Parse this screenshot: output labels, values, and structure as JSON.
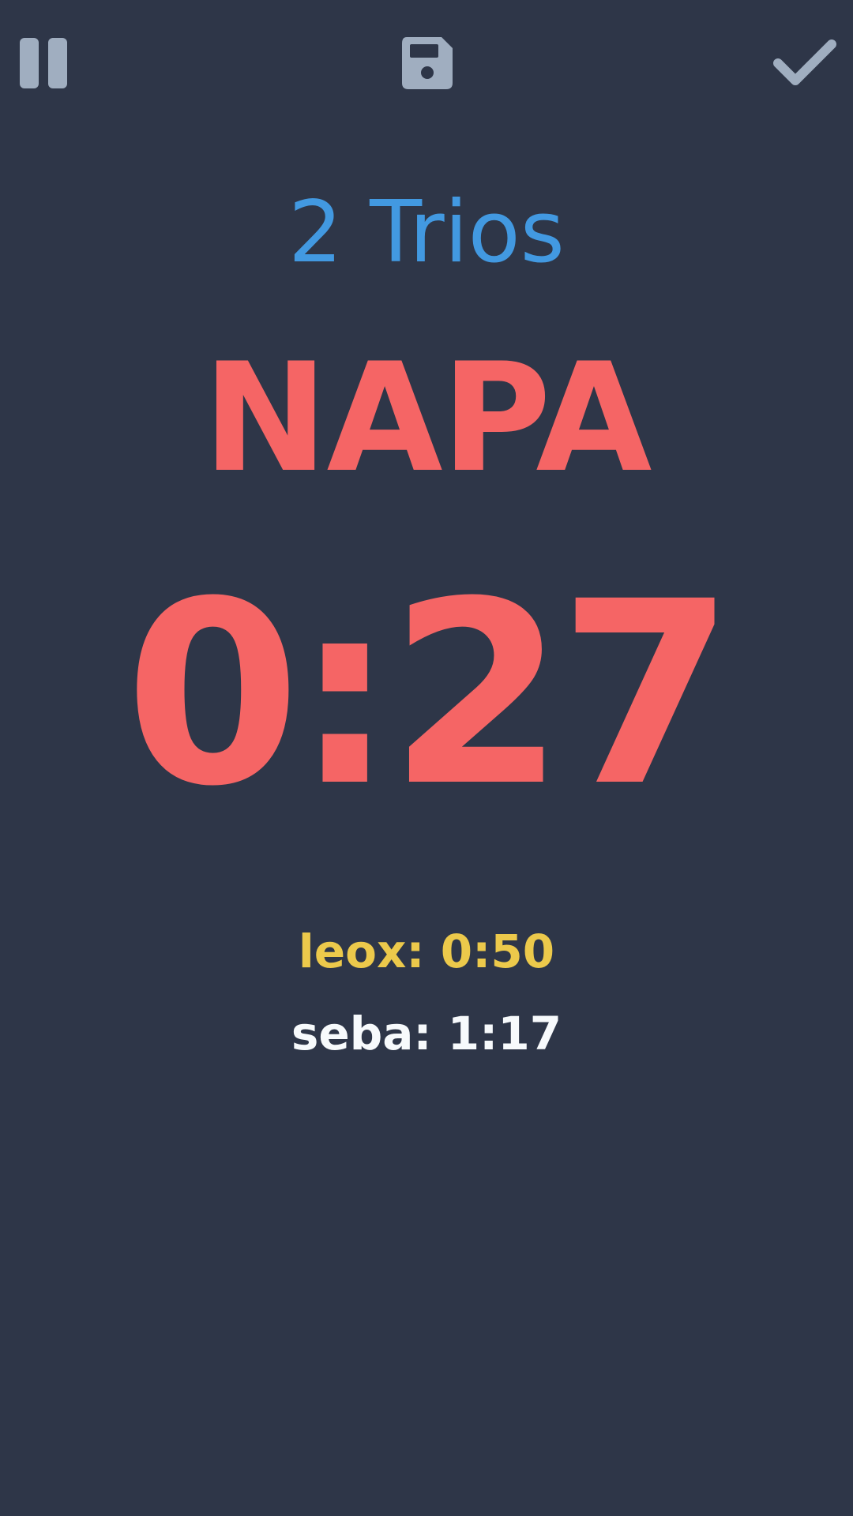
{
  "toolbar": {
    "pause_icon": "pause-icon",
    "save_icon": "floppy-disk-icon",
    "done_icon": "checkmark-icon",
    "icon_color": "#a0aec0"
  },
  "round": {
    "title": "2 Trios",
    "word": "NAPA",
    "timer": "0:27"
  },
  "scores": [
    {
      "text": "leox: 0:50",
      "color": "#ecc94b"
    },
    {
      "text": "seba: 1:17",
      "color": "#f7fafc"
    }
  ],
  "colors": {
    "background": "#2e3648",
    "title": "#4299e1",
    "accent": "#f56565"
  }
}
